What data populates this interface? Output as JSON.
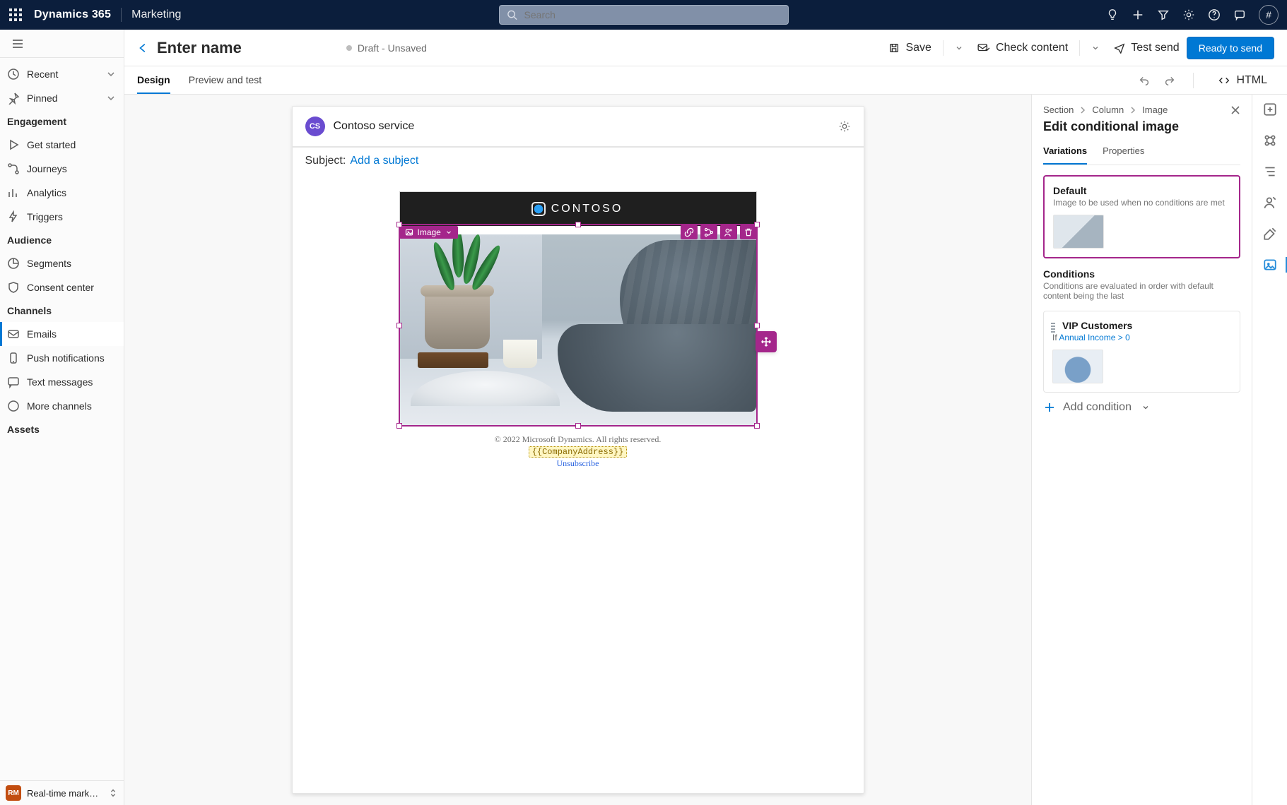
{
  "app": {
    "brand": "Dynamics 365",
    "module": "Marketing"
  },
  "search": {
    "placeholder": "Search"
  },
  "leftnav": {
    "recent": "Recent",
    "pinned": "Pinned",
    "engagement": "Engagement",
    "engagement_items": {
      "get_started": "Get started",
      "journeys": "Journeys",
      "analytics": "Analytics",
      "triggers": "Triggers"
    },
    "audience": "Audience",
    "audience_items": {
      "segments": "Segments",
      "consent_center": "Consent center"
    },
    "channels": "Channels",
    "channels_items": {
      "emails": "Emails",
      "push": "Push notifications",
      "text": "Text messages",
      "more": "More channels"
    },
    "assets": "Assets",
    "footer": "Real-time marketi…"
  },
  "cmdbar": {
    "title": "Enter name",
    "status": "Draft - Unsaved",
    "save": "Save",
    "check_content": "Check content",
    "test_send": "Test send",
    "ready": "Ready to send"
  },
  "tabs": {
    "design": "Design",
    "preview": "Preview and test",
    "html": "HTML"
  },
  "email": {
    "sender": "Contoso service",
    "sender_badge": "CS",
    "subject_label": "Subject:",
    "subject_action": "Add a subject",
    "brand": "CONTOSO",
    "sel_label": "Image",
    "footer_copy": "© 2022 Microsoft Dynamics. All rights reserved.",
    "company_token": "{{CompanyAddress}}",
    "unsubscribe": "Unsubscribe"
  },
  "panel": {
    "crumbs": {
      "section": "Section",
      "column": "Column",
      "image": "Image"
    },
    "title": "Edit conditional image",
    "tabs": {
      "variations": "Variations",
      "properties": "Properties"
    },
    "default_card": {
      "title": "Default",
      "desc": "Image to be used when no conditions are met"
    },
    "conditions_title": "Conditions",
    "conditions_desc": "Conditions are evaluated in order with default content being the last",
    "vip_card": {
      "title": "VIP Customers",
      "if_label": "If",
      "rule": "Annual Income > 0"
    },
    "add_condition": "Add condition"
  }
}
